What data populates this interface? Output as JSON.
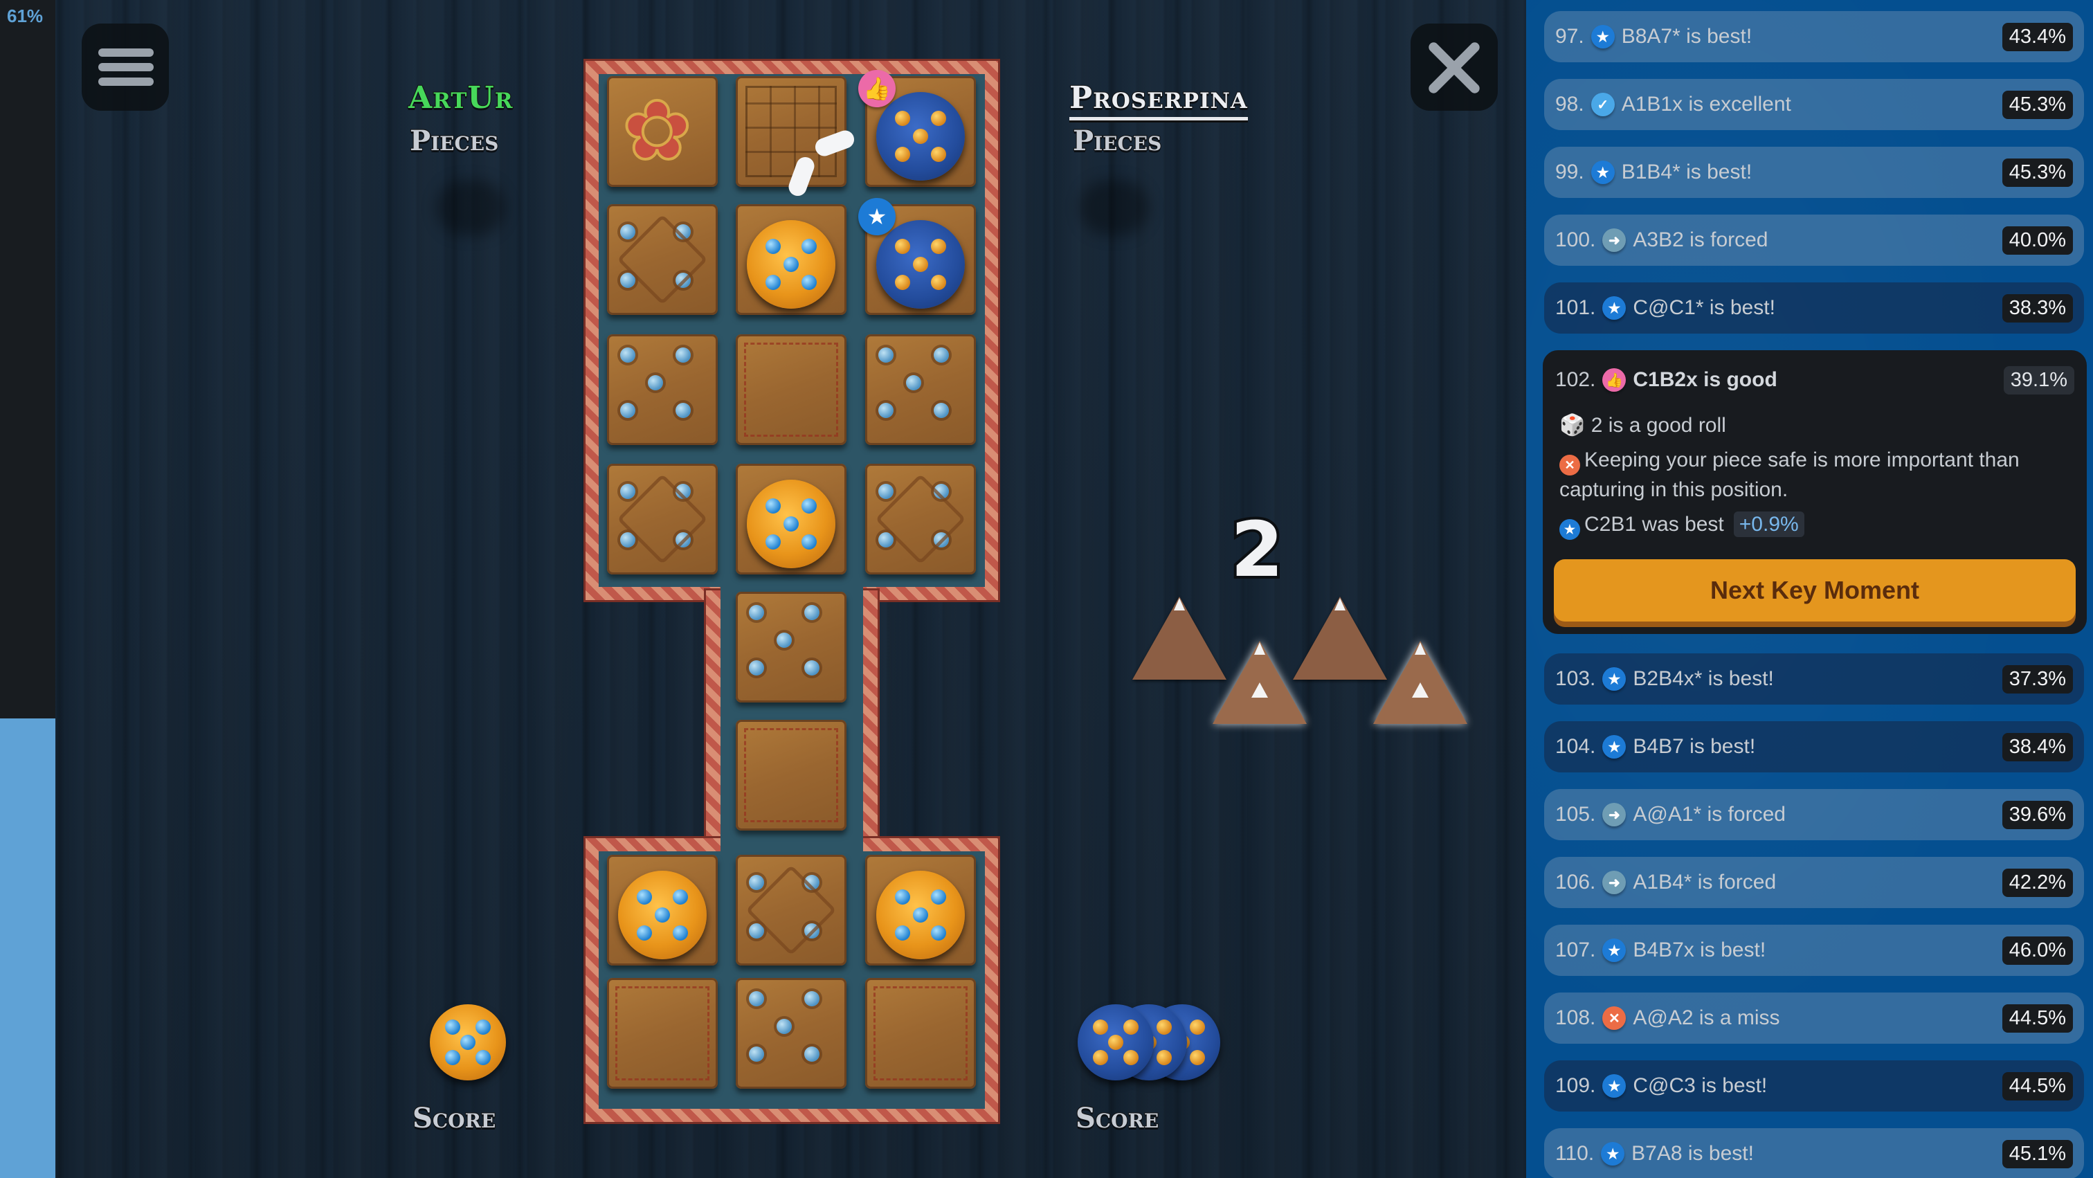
{
  "eval": {
    "label": "61%",
    "light_share_percent": 39
  },
  "buttons": {
    "menu_icon": "hamburger-menu-icon",
    "close_icon": "close-x-icon"
  },
  "players": {
    "light": {
      "name": "ArtUr",
      "pieces_label": "Pieces",
      "score_label": "Score",
      "scored_pieces": 1,
      "color": "#47d85a"
    },
    "dark": {
      "name": "Proserpina",
      "pieces_label": "Pieces",
      "score_label": "Score",
      "scored_pieces": 3
    }
  },
  "board": {
    "pieces": [
      {
        "owner": "dark",
        "col": 2,
        "row": 0
      },
      {
        "owner": "light",
        "col": 1,
        "row": 1
      },
      {
        "owner": "dark",
        "col": 2,
        "row": 1
      },
      {
        "owner": "light",
        "col": 1,
        "row": 3
      },
      {
        "owner": "light",
        "col": 0,
        "row": 6
      },
      {
        "owner": "light",
        "col": 2,
        "row": 6
      }
    ],
    "markers": [
      {
        "type": "good",
        "icon": "thumbs-up-icon",
        "glyph": "👍",
        "col": 2,
        "row": 0
      },
      {
        "type": "best",
        "icon": "star-icon",
        "glyph": "★",
        "col": 2,
        "row": 1
      }
    ]
  },
  "dice": {
    "roll": "2",
    "lit": [
      false,
      true,
      false,
      true
    ]
  },
  "moves": [
    {
      "num": "97.",
      "badge": "best",
      "glyph": "★",
      "text": "B8A7* is best!",
      "pct": "43.4%",
      "shade": "light"
    },
    {
      "num": "98.",
      "badge": "excellent",
      "glyph": "✓",
      "text": "A1B1x is excellent",
      "pct": "45.3%",
      "shade": "light"
    },
    {
      "num": "99.",
      "badge": "best",
      "glyph": "★",
      "text": "B1B4* is best!",
      "pct": "45.3%",
      "shade": "light"
    },
    {
      "num": "100.",
      "badge": "forced",
      "glyph": "➜",
      "text": "A3B2 is forced",
      "pct": "40.0%",
      "shade": "light"
    },
    {
      "num": "101.",
      "badge": "best",
      "glyph": "★",
      "text": "C@C1* is best!",
      "pct": "38.3%",
      "shade": "dark"
    },
    {
      "num": "103.",
      "badge": "best",
      "glyph": "★",
      "text": "B2B4x* is best!",
      "pct": "37.3%",
      "shade": "dark"
    },
    {
      "num": "104.",
      "badge": "best",
      "glyph": "★",
      "text": "B4B7 is best!",
      "pct": "38.4%",
      "shade": "dark"
    },
    {
      "num": "105.",
      "badge": "forced",
      "glyph": "➜",
      "text": "A@A1* is forced",
      "pct": "39.6%",
      "shade": "light"
    },
    {
      "num": "106.",
      "badge": "forced",
      "glyph": "➜",
      "text": "A1B4* is forced",
      "pct": "42.2%",
      "shade": "light"
    },
    {
      "num": "107.",
      "badge": "best",
      "glyph": "★",
      "text": "B4B7x is best!",
      "pct": "46.0%",
      "shade": "light"
    },
    {
      "num": "108.",
      "badge": "miss",
      "glyph": "✕",
      "text": "A@A2 is a miss",
      "pct": "44.5%",
      "shade": "light"
    },
    {
      "num": "109.",
      "badge": "best",
      "glyph": "★",
      "text": "C@C3 is best!",
      "pct": "44.5%",
      "shade": "dark"
    },
    {
      "num": "110.",
      "badge": "best",
      "glyph": "★",
      "text": "B7A8 is best!",
      "pct": "45.1%",
      "shade": "light"
    }
  ],
  "key_moment": {
    "num": "102.",
    "badge": "good",
    "glyph": "👍",
    "title": "C1B2x is good",
    "pct": "39.1%",
    "roll_icon": "🎲",
    "roll_text": "2 is a good roll",
    "advice_icon": "✕",
    "advice_text": "Keeping your piece safe is more important than capturing in this position.",
    "best_icon": "★",
    "best_text": "C2B1 was best",
    "best_delta": "+0.9%",
    "button_label": "Next Key Moment"
  }
}
